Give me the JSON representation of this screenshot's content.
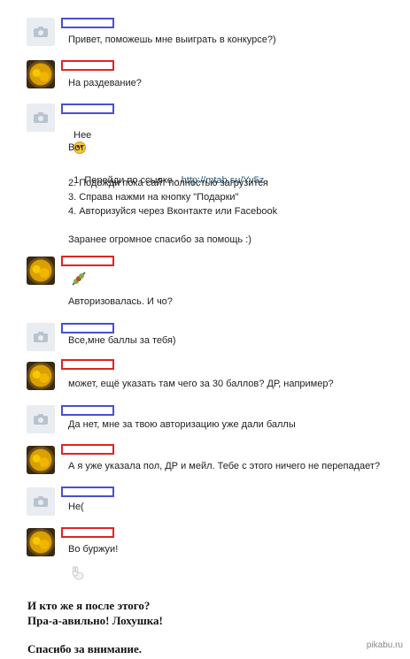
{
  "messages": [
    {
      "lines": [
        "Привет, поможешь мне выиграть в конкурсе?)"
      ]
    },
    {
      "lines": [
        "На раздевание?"
      ]
    },
    {
      "lines": [
        "Нее",
        "Вот",
        "1. Перейди по ссылке - ",
        "2. Подожди пока сайт полностью загрузится",
        "3. Справа нажми на кнопку \"Подарки\"",
        "4. Авторизуйся через Вконтакте или Facebook",
        "Заранее огромное спасибо за помощь :)"
      ],
      "link": "http://mtab.su/Yv5z"
    },
    {
      "lines": [
        "Авторизовалась. И чо?"
      ]
    },
    {
      "lines": [
        "Все,мне баллы за тебя)"
      ]
    },
    {
      "lines": [
        "может, ещё указать там чего за 30 баллов? ДР, например?"
      ]
    },
    {
      "lines": [
        "Да нет, мне за твою авторизацию уже дали баллы"
      ]
    },
    {
      "lines": [
        "А я уже указала пол, ДР и мейл. Тебе с этого ничего не перепадает?"
      ]
    },
    {
      "lines": [
        "Не("
      ]
    },
    {
      "lines": [
        "Во буржуи!"
      ]
    }
  ],
  "footer": {
    "line1": "И кто же я после этого?",
    "line2": "Пра-а-авильно! Лохушка!",
    "line3": "Спасибо за внимание."
  },
  "watermark": "pikabu.ru",
  "colors": {
    "sender_blue": "#4a4fd0",
    "sender_red": "#e02424",
    "link": "#2b587a"
  },
  "icons": {
    "camera_avatar": "camera-icon",
    "photo_avatar": "user-photo",
    "emoji_smile": "smiley-face-icon",
    "emoji_kebab": "kebab-sticker-icon",
    "emoji_bunny": "bunny-sticker-icon"
  }
}
